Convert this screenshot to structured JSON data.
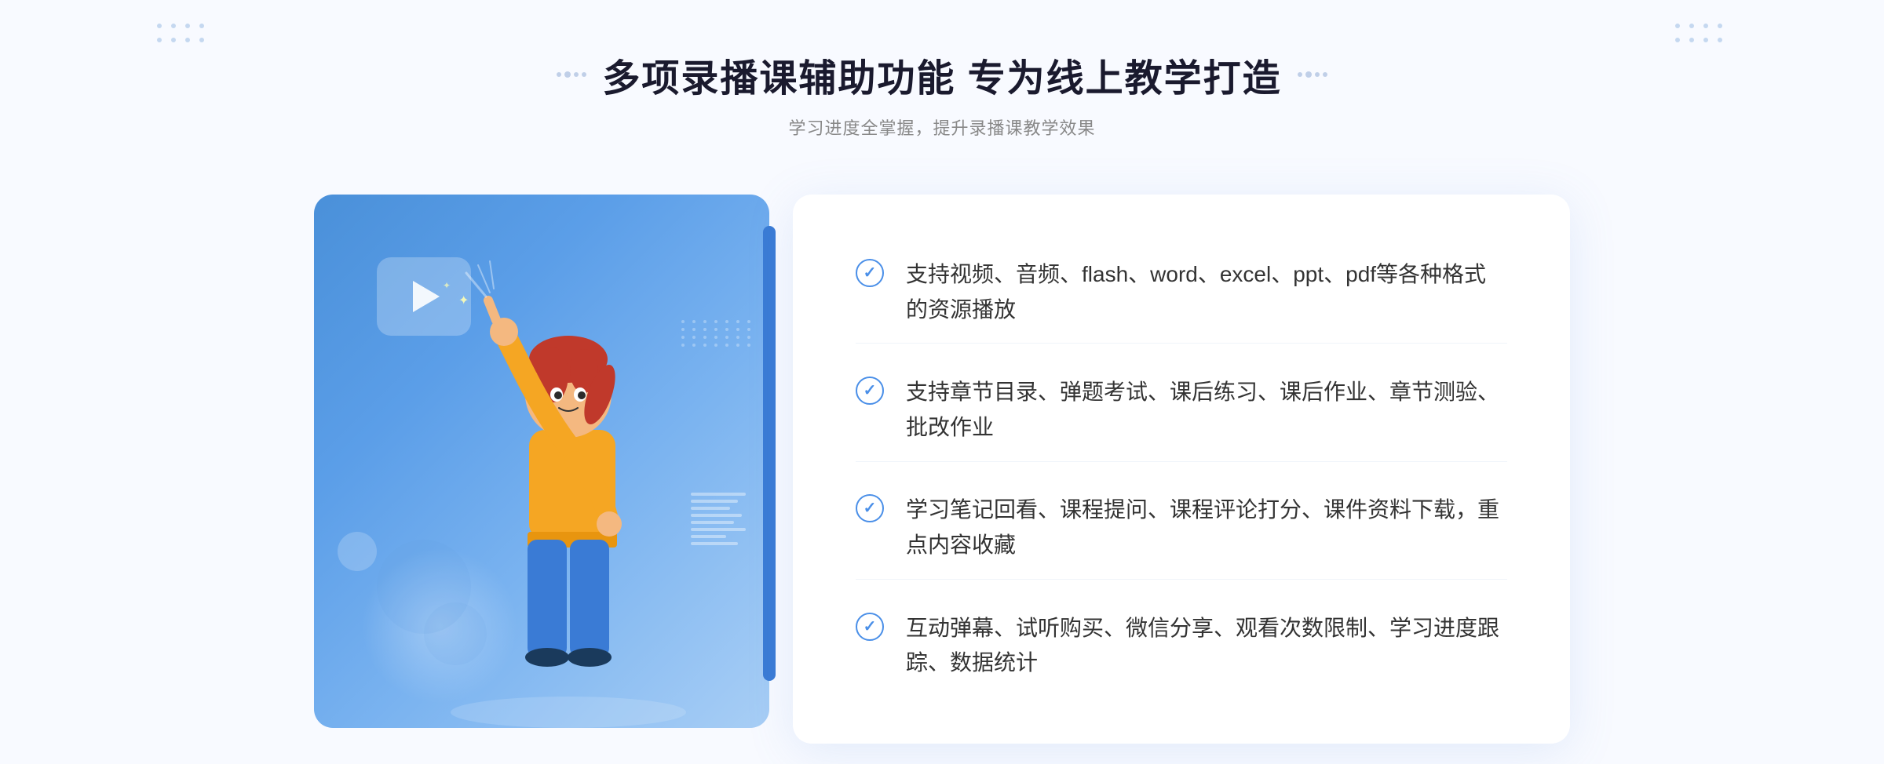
{
  "header": {
    "title": "多项录播课辅助功能 专为线上教学打造",
    "subtitle": "学习进度全掌握，提升录播课教学效果",
    "deco_left": "❖",
    "deco_right": "❖"
  },
  "features": [
    {
      "id": "feature-1",
      "text": "支持视频、音频、flash、word、excel、ppt、pdf等各种格式的资源播放"
    },
    {
      "id": "feature-2",
      "text": "支持章节目录、弹题考试、课后练习、课后作业、章节测验、批改作业"
    },
    {
      "id": "feature-3",
      "text": "学习笔记回看、课程提问、课程评论打分、课件资料下载，重点内容收藏"
    },
    {
      "id": "feature-4",
      "text": "互动弹幕、试听购买、微信分享、观看次数限制、学习进度跟踪、数据统计"
    }
  ],
  "colors": {
    "primary": "#4a8fe8",
    "title": "#1a1a2e",
    "text": "#333333",
    "subtitle": "#888888",
    "bg": "#f8faff"
  },
  "icons": {
    "check": "✓",
    "play": "▶",
    "chevron_left": "《",
    "chevron_right": "》"
  }
}
